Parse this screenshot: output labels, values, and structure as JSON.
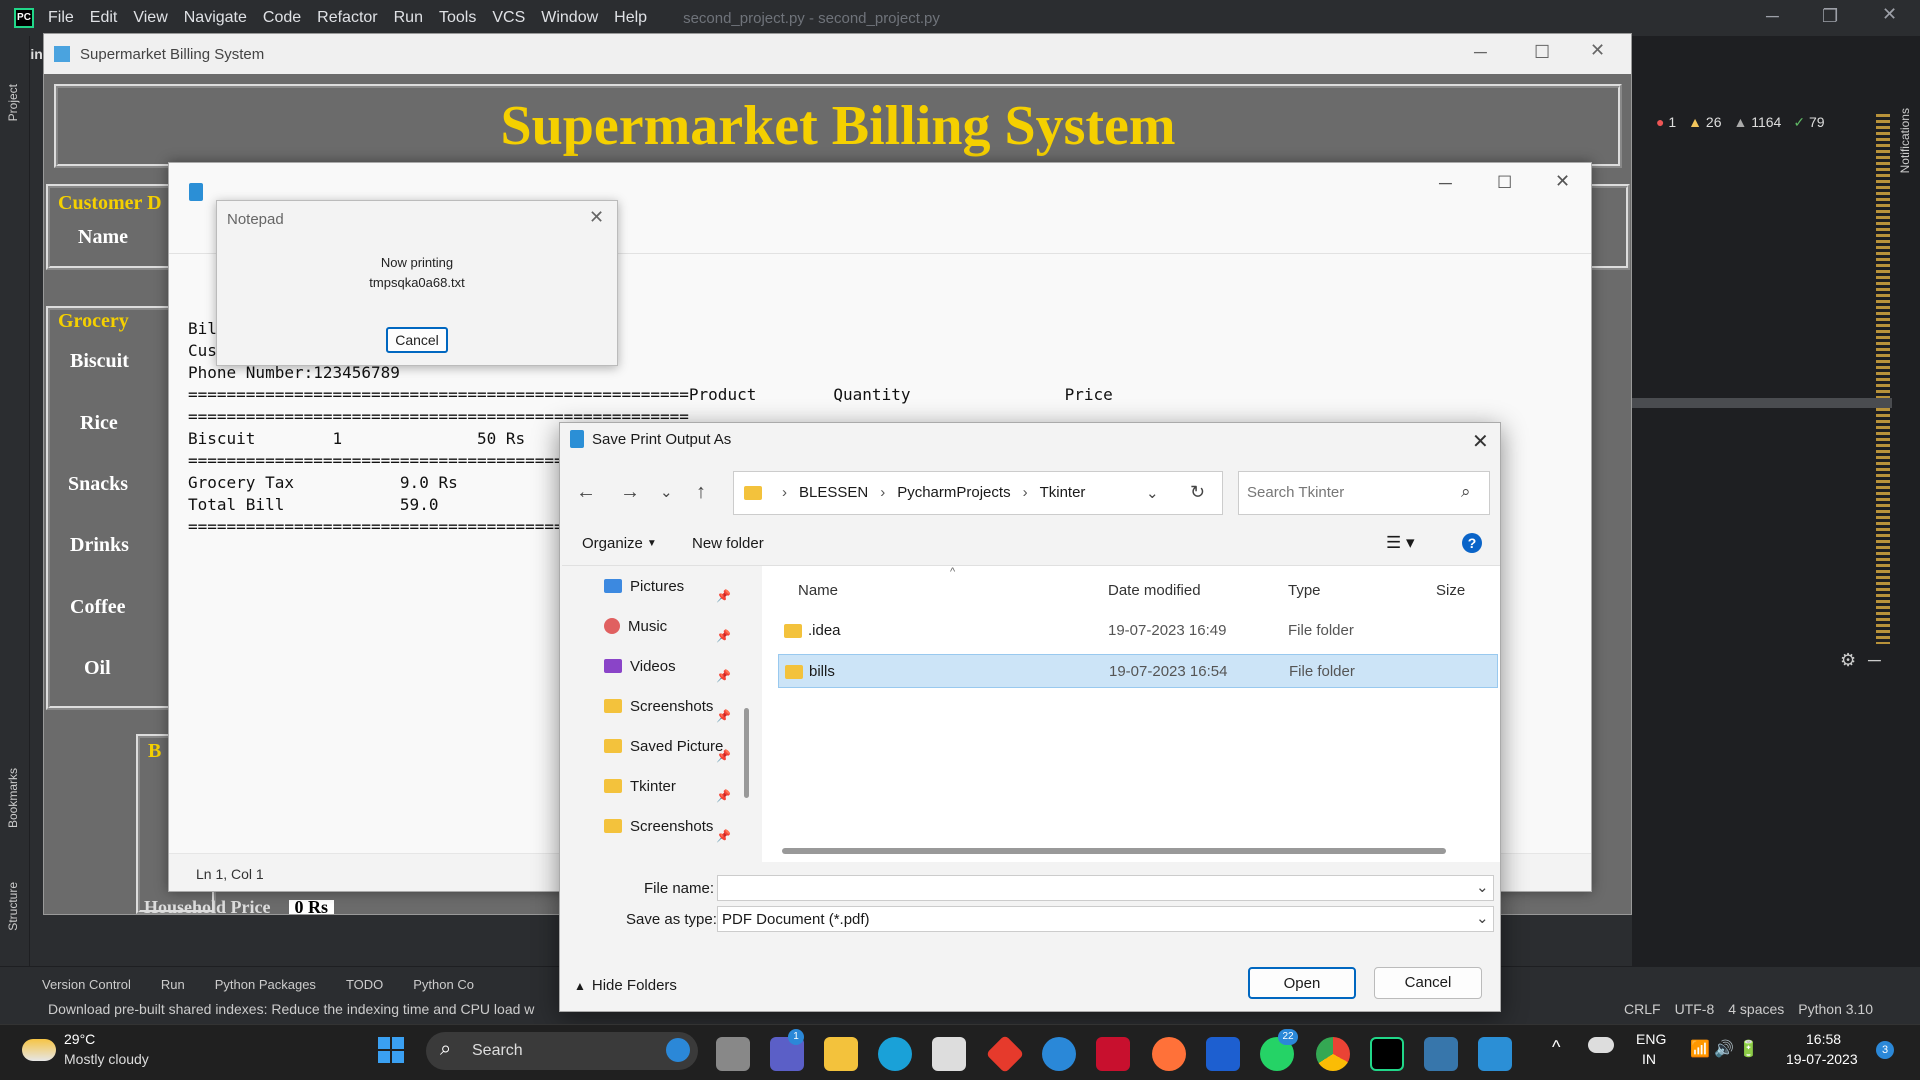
{
  "ide": {
    "menu": [
      "File",
      "Edit",
      "View",
      "Navigate",
      "Code",
      "Refactor",
      "Run",
      "Tools",
      "VCS",
      "Window",
      "Help"
    ],
    "title": "second_project.py - second_project.py",
    "tab_prefix": "Tkin",
    "project_label": "roject",
    "inspections": {
      "errors": "1",
      "warnings": "26",
      "weak": "1164",
      "ok": "79"
    },
    "left_tools": [
      "Project",
      "Bookmarks",
      "Structure"
    ],
    "right_tools": [
      "Notifications"
    ],
    "bottom_tabs": [
      "Version Control",
      "Run",
      "Python Packages",
      "TODO",
      "Python Co"
    ],
    "status_message": "Download pre-built shared indexes: Reduce the indexing time and CPU load w",
    "status_right": [
      "CRLF",
      "UTF-8",
      "4 spaces",
      "Python 3.10"
    ]
  },
  "app": {
    "title": "Supermarket Billing System",
    "banner": "Supermarket Billing System",
    "customer_label": "Customer D",
    "name_label": "Name",
    "grocery_label": "Grocery",
    "grocery_items": [
      "Biscuit",
      "Rice",
      "Snacks",
      "Drinks",
      "Coffee",
      "Oil"
    ],
    "bill_label": "B",
    "household_partial": "Household Price",
    "household_value": "0 Rs"
  },
  "notepad": {
    "status": "Ln 1, Col 1",
    "lines": [
      "Bil",
      "Cus",
      "Phone Number:123456789",
      "====================================================Product        Quantity                Price",
      "====================================================",
      "Biscuit        1              50 Rs",
      "==========================================",
      "Grocery Tax           9.0 Rs",
      "Total Bill            59.0",
      "=========================================="
    ]
  },
  "printing": {
    "title": "Notepad",
    "line1": "Now printing",
    "line2": "tmpsqka0a68.txt",
    "cancel": "Cancel"
  },
  "save_dialog": {
    "title": "Save Print Output As",
    "breadcrumb": [
      "BLESSEN",
      "PycharmProjects",
      "Tkinter"
    ],
    "search_placeholder": "Search Tkinter",
    "organize": "Organize",
    "new_folder": "New folder",
    "nav": [
      "Pictures",
      "Music",
      "Videos",
      "Screenshots",
      "Saved Picture",
      "Tkinter",
      "Screenshots"
    ],
    "columns": [
      "Name",
      "Date modified",
      "Type",
      "Size"
    ],
    "files": [
      {
        "name": ".idea",
        "date": "19-07-2023 16:49",
        "type": "File folder"
      },
      {
        "name": "bills",
        "date": "19-07-2023 16:54",
        "type": "File folder"
      }
    ],
    "file_name_label": "File name:",
    "file_name_value": "",
    "save_type_label": "Save as type:",
    "save_type_value": "PDF Document (*.pdf)",
    "hide_folders": "Hide Folders",
    "open": "Open",
    "cancel": "Cancel"
  },
  "taskbar": {
    "temp": "29°C",
    "weather": "Mostly cloudy",
    "search": "Search",
    "lang1": "ENG",
    "lang2": "IN",
    "time": "16:58",
    "date": "19-07-2023",
    "notif": "3",
    "badge_teams": "1",
    "badge_whatsapp": "22"
  }
}
